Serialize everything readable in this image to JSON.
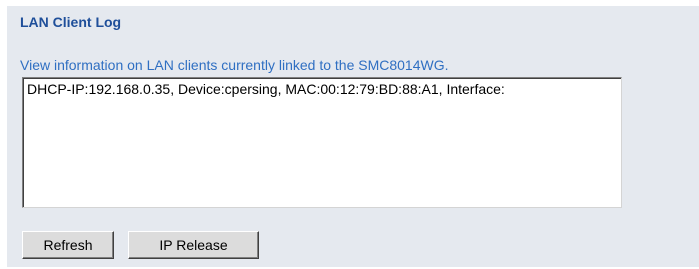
{
  "page": {
    "title": "LAN Client Log",
    "description": "View information on LAN clients currently linked to the SMC8014WG."
  },
  "log": {
    "lines": [
      "DHCP-IP:192.168.0.35, Device:cpersing, MAC:00:12:79:BD:88:A1, Interface:"
    ]
  },
  "buttons": {
    "refresh_label": "Refresh",
    "ip_release_label": "IP Release"
  },
  "colors": {
    "panel_background": "#e5e9ef",
    "title": "#1f4f9a",
    "description": "#2f6fc2"
  }
}
